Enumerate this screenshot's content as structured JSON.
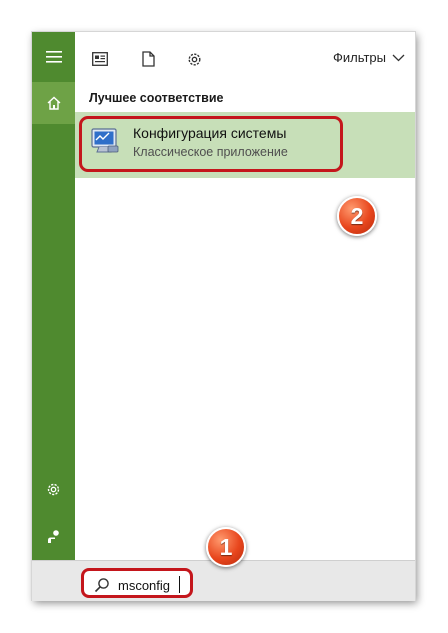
{
  "toolbar": {
    "filters_label": "Фильтры",
    "icons": [
      "news-icon",
      "document-icon",
      "gear-icon"
    ]
  },
  "results": {
    "section_title": "Лучшее соответствие",
    "best_match": {
      "title": "Конфигурация системы",
      "subtitle": "Классическое приложение",
      "icon": "system-config-icon"
    }
  },
  "search": {
    "value": "msconfig",
    "icon": "search-icon"
  },
  "annotations": {
    "step1": "1",
    "step2": "2"
  },
  "colors": {
    "rail": "#4f8a2f",
    "rail_active": "#6ea246",
    "result_bg": "#c7dfb8",
    "highlight": "#c4161c",
    "badge": "#e8461d"
  }
}
